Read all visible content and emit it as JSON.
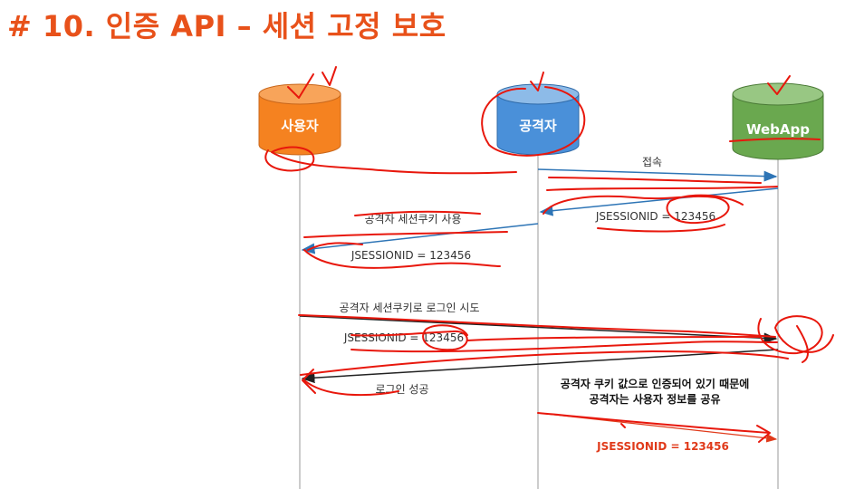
{
  "title": "# 10. 인증 API – 세션 고정 보호",
  "actors": {
    "user": {
      "label": "사용자",
      "color": "#f58220"
    },
    "attacker": {
      "label": "공격자",
      "color": "#4a90d9"
    },
    "webapp": {
      "label": "WebApp",
      "color": "#6aa84f"
    }
  },
  "messages": {
    "connect": "접속",
    "session_id_1": "JSESSIONID = 123456",
    "use_cookie": "공격자 세션쿠키 사용",
    "session_id_2": "JSESSIONID = 123456",
    "login_attempt": "공격자 세션쿠키로  로그인 시도",
    "session_id_3": "JSESSIONID = 123456",
    "login_success": "로그인 성공",
    "note_line1": "공격자 쿠키 값으로 인증되어 있기 때문에",
    "note_line2": "공격자는 사용자 정보를 공유",
    "session_id_4": "JSESSIONID = 123456"
  },
  "colors": {
    "title": "#e8511a",
    "blue_arrow": "#2e75b6",
    "black_arrow": "#222222",
    "annotation_red": "#e8170c"
  }
}
